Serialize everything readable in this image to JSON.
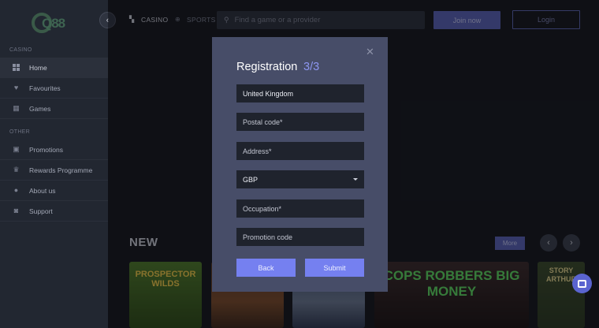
{
  "brand": {
    "logo_text": "Q88",
    "logo_small": ""
  },
  "sidebar": {
    "sections": [
      {
        "label": "CASINO"
      },
      {
        "label": "OTHER"
      }
    ],
    "items": [
      {
        "label": "Home",
        "icon": "dashboard-icon",
        "active": true
      },
      {
        "label": "Favourites",
        "icon": "heart-icon"
      },
      {
        "label": "Games",
        "icon": "games-icon"
      },
      {
        "label": "Promotions",
        "icon": "gift-icon"
      },
      {
        "label": "Rewards Programme",
        "icon": "trophy-icon"
      },
      {
        "label": "About us",
        "icon": "info-icon"
      },
      {
        "label": "Support",
        "icon": "chat-icon"
      }
    ]
  },
  "topbar": {
    "tabs": [
      {
        "label": "CASINO",
        "icon": "casino-icon"
      },
      {
        "label": "SPORTS",
        "icon": "globe-icon"
      }
    ],
    "search_placeholder": "Find a game or a provider",
    "join_label": "Join now",
    "login_label": "Login"
  },
  "main": {
    "section_title": "NEW",
    "more_label": "More",
    "tiles": [
      {
        "title": "PROSPECTOR WILDS"
      },
      {
        "title": ""
      },
      {
        "title": ""
      },
      {
        "title": "COPS ROBBERS BIG MONEY"
      },
      {
        "title": "STORY ARTHUR"
      }
    ]
  },
  "modal": {
    "title": "Registration",
    "step": "3/3",
    "fields": [
      {
        "value": "United Kingdom",
        "placeholder": ""
      },
      {
        "value": "",
        "placeholder": "Postal code*"
      },
      {
        "value": "",
        "placeholder": "Address*"
      },
      {
        "value": "GBP",
        "placeholder": "",
        "type": "select"
      },
      {
        "value": "",
        "placeholder": "Occupation*"
      },
      {
        "value": "",
        "placeholder": "Promotion code"
      }
    ],
    "back_label": "Back",
    "submit_label": "Submit"
  },
  "colors": {
    "accent": "#7580f0",
    "button": "#5862b4",
    "modal_bg": "#474d68",
    "sidebar_bg": "#222731"
  }
}
